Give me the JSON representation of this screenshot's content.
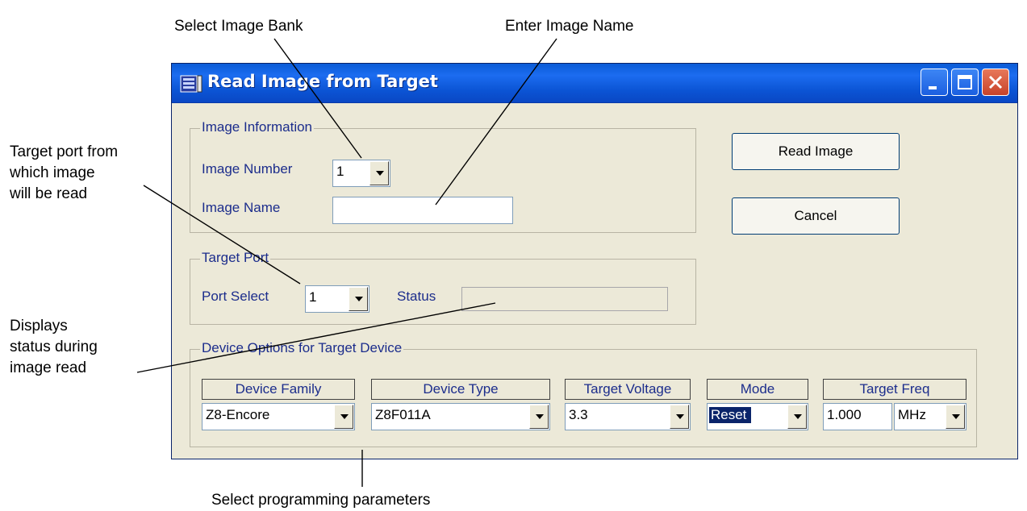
{
  "callouts": {
    "select_bank": "Select Image Bank",
    "enter_name": "Enter Image Name",
    "target_port": "Target port from which image will be read",
    "target_port_lines": [
      "Target port from",
      "which image",
      "will be read"
    ],
    "status": "Displays status during image read",
    "status_lines": [
      "Displays",
      "status during",
      "image read"
    ],
    "params": "Select programming parameters"
  },
  "window": {
    "title": "Read Image from Target",
    "controls": [
      "minimize-icon",
      "maximize-icon",
      "close-icon"
    ]
  },
  "image_info": {
    "group_label": "Image Information",
    "number_label": "Image Number",
    "number_value": "1",
    "name_label": "Image Name",
    "name_value": ""
  },
  "buttons": {
    "read": "Read Image",
    "cancel": "Cancel"
  },
  "target_port": {
    "group_label": "Target Port",
    "port_label": "Port Select",
    "port_value": "1",
    "status_label": "Status",
    "status_value": ""
  },
  "device_options": {
    "group_label": "Device Options for Target Device",
    "family": {
      "header": "Device Family",
      "value": "Z8-Encore"
    },
    "type": {
      "header": "Device Type",
      "value": "Z8F011A"
    },
    "voltage": {
      "header": "Target Voltage",
      "value": "3.3"
    },
    "mode": {
      "header": "Mode",
      "value": "Reset"
    },
    "freq": {
      "header": "Target Freq",
      "value": "1.000",
      "unit": "MHz"
    }
  },
  "colors": {
    "title_bar": "#0a5bd6",
    "dialog_bg": "#ece9d8",
    "label_text": "#1c2d8c",
    "selection": "#0a246a"
  }
}
